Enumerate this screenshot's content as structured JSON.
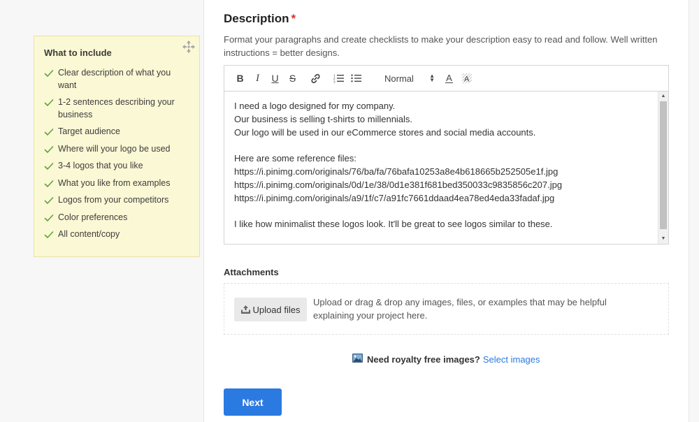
{
  "tips": {
    "title": "What to include",
    "items": [
      "Clear description of what you want",
      "1-2 sentences describing your business",
      "Target audience",
      "Where will your logo be used",
      "3-4 logos that you like",
      "What you like from examples",
      "Logos from your competitors",
      "Color preferences",
      "All content/copy"
    ]
  },
  "description": {
    "title": "Description",
    "required_mark": "*",
    "subtitle": "Format your paragraphs and create checklists to make your description easy to read and follow. Well written instructions = better designs."
  },
  "editor": {
    "toolbar": {
      "bold": "B",
      "italic": "I",
      "underline": "U",
      "strike": "S",
      "size_value": "Normal",
      "color": "A"
    },
    "lines": [
      "I need a logo designed for my company.",
      "Our business is selling t-shirts to millennials.",
      "Our logo will be used in our eCommerce stores and social media accounts.",
      "",
      "Here are some reference files:",
      "https://i.pinimg.com/originals/76/ba/fa/76bafa10253a8e4b618665b252505e1f.jpg",
      "https://i.pinimg.com/originals/0d/1e/38/0d1e381f681bed350033c9835856c207.jpg",
      "https://i.pinimg.com/originals/a9/1f/c7/a91fc7661ddaad4ea78ed4eda33fadaf.jpg",
      "",
      "I like how minimalist these logos look. It'll be great to see logos similar to these."
    ]
  },
  "attachments": {
    "label": "Attachments",
    "upload_label": "Upload files",
    "help_text": "Upload or drag & drop any images, files, or examples that may be helpful explaining your project here."
  },
  "royalty": {
    "question": "Need royalty free images?",
    "link": "Select images"
  },
  "next_label": "Next",
  "colors": {
    "accent": "#2a7ae2",
    "tips_bg": "#fbf8d5",
    "check": "#5aa43a",
    "required": "#d9302e"
  }
}
